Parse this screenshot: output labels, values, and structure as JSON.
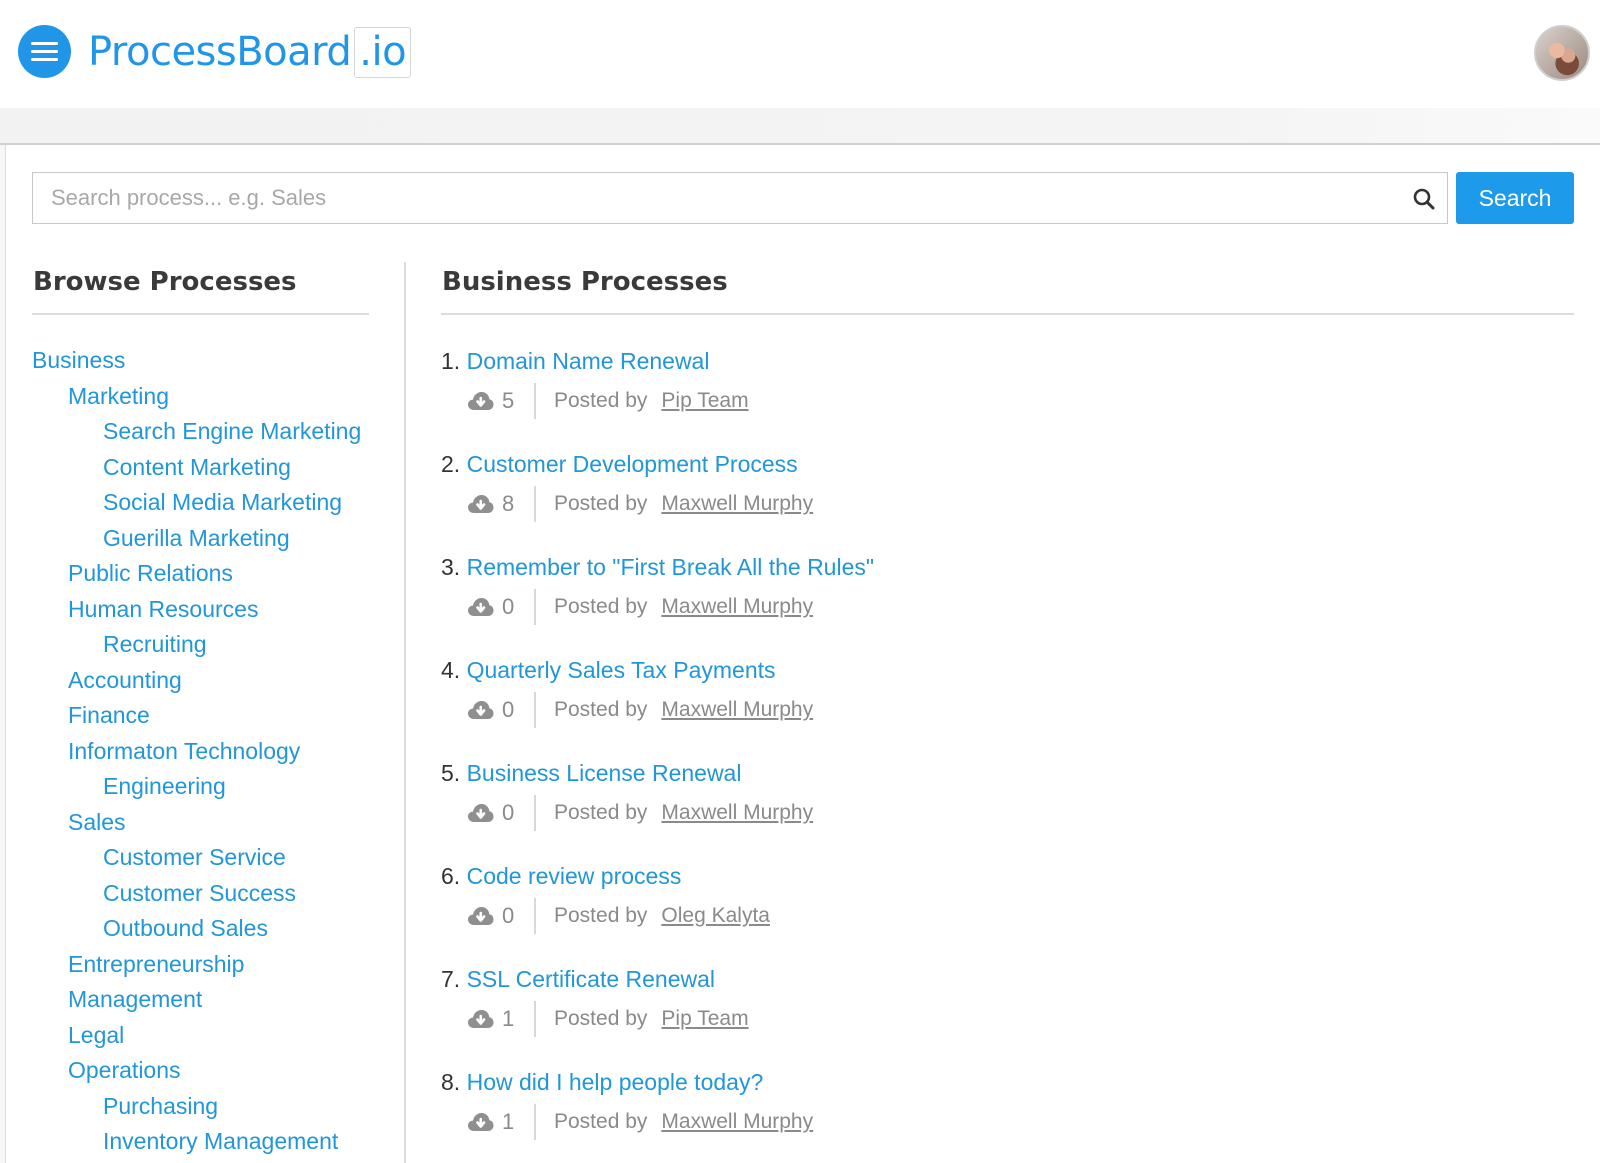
{
  "header": {
    "logo_main": "ProcessBoard",
    "logo_tld": ".io",
    "menu_icon": "hamburger-icon",
    "avatar_alt": "user-avatar"
  },
  "search": {
    "placeholder": "Search process... e.g. Sales",
    "value": "",
    "button_label": "Search",
    "icon": "search-icon"
  },
  "colors": {
    "accent": "#2196e8",
    "link": "#2196d8",
    "button": "#1e9aea"
  },
  "browse": {
    "title": "Browse Processes",
    "items": [
      {
        "label": "Business",
        "level": 1
      },
      {
        "label": "Marketing",
        "level": 2
      },
      {
        "label": "Search Engine Marketing",
        "level": 3
      },
      {
        "label": "Content Marketing",
        "level": 3
      },
      {
        "label": "Social Media Marketing",
        "level": 3
      },
      {
        "label": "Guerilla Marketing",
        "level": 3
      },
      {
        "label": "Public Relations",
        "level": 2
      },
      {
        "label": "Human Resources",
        "level": 2
      },
      {
        "label": "Recruiting",
        "level": 3
      },
      {
        "label": "Accounting",
        "level": 2
      },
      {
        "label": "Finance",
        "level": 2
      },
      {
        "label": "Informaton Technology",
        "level": 2
      },
      {
        "label": "Engineering",
        "level": 3
      },
      {
        "label": "Sales",
        "level": 2
      },
      {
        "label": "Customer Service",
        "level": 3
      },
      {
        "label": "Customer Success",
        "level": 3
      },
      {
        "label": "Outbound Sales",
        "level": 3
      },
      {
        "label": "Entrepreneurship",
        "level": 2
      },
      {
        "label": "Management",
        "level": 2
      },
      {
        "label": "Legal",
        "level": 2
      },
      {
        "label": "Operations",
        "level": 2
      },
      {
        "label": "Purchasing",
        "level": 3
      },
      {
        "label": "Inventory Management",
        "level": 3
      }
    ]
  },
  "processes": {
    "title": "Business Processes",
    "posted_by_label": "Posted by",
    "items": [
      {
        "num": "1.",
        "title": "Domain Name Renewal",
        "downloads": "5",
        "author": "Pip Team"
      },
      {
        "num": "2.",
        "title": "Customer Development Process",
        "downloads": "8",
        "author": "Maxwell Murphy"
      },
      {
        "num": "3.",
        "title": "Remember to \"First Break All the Rules\"",
        "downloads": "0",
        "author": "Maxwell Murphy"
      },
      {
        "num": "4.",
        "title": "Quarterly Sales Tax Payments",
        "downloads": "0",
        "author": "Maxwell Murphy"
      },
      {
        "num": "5.",
        "title": "Business License Renewal",
        "downloads": "0",
        "author": "Maxwell Murphy"
      },
      {
        "num": "6.",
        "title": "Code review process",
        "downloads": "0",
        "author": "Oleg Kalyta"
      },
      {
        "num": "7.",
        "title": "SSL Certificate Renewal",
        "downloads": "1",
        "author": "Pip Team"
      },
      {
        "num": "8.",
        "title": "How did I help people today?",
        "downloads": "1",
        "author": "Maxwell Murphy"
      }
    ]
  }
}
